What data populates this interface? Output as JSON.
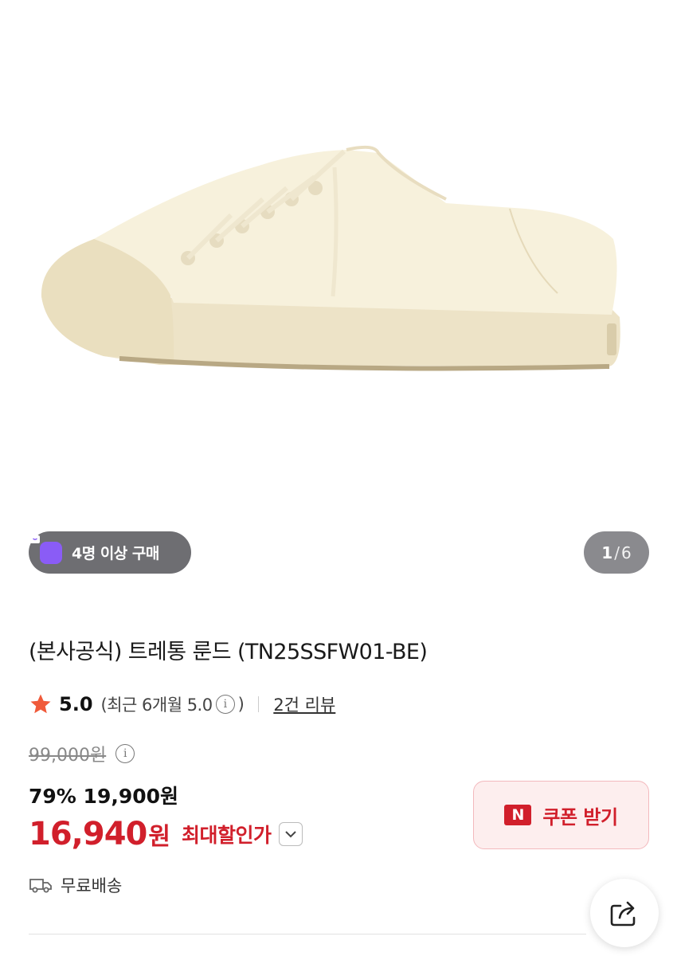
{
  "hero": {
    "image_alt": "Cream canvas low-top sneaker"
  },
  "group_badge": {
    "label": "4명 이상 구매",
    "icon": "shopping-bag-icon"
  },
  "pager": {
    "current": "1",
    "separator": "/",
    "total": "6"
  },
  "product": {
    "title": "(본사공식) 트레통 룬드 (TN25SSFW01-BE)"
  },
  "rating": {
    "score": "5.0",
    "recent_prefix": "(최근 6개월 5.0",
    "recent_suffix": ")",
    "reviews": "2건 리뷰"
  },
  "price": {
    "original": "99,000원",
    "discount_line": "79% 19,900원",
    "max_amount": "16,940",
    "max_unit": "원",
    "max_label": "최대할인가"
  },
  "coupon": {
    "logo": "N",
    "label": "쿠폰 받기"
  },
  "shipping": {
    "label": "무료배송",
    "icon": "truck-icon"
  },
  "share": {
    "icon": "share-icon"
  },
  "colors": {
    "accent_red": "#d11f2b",
    "badge_purple": "#8a5cf6"
  }
}
